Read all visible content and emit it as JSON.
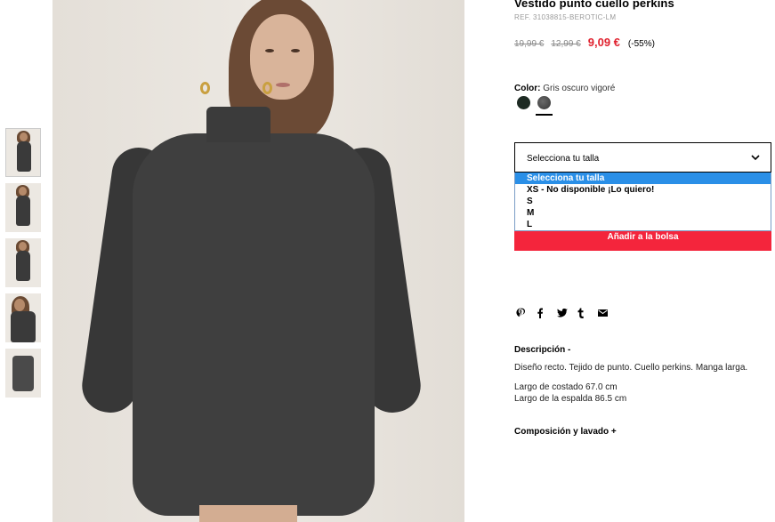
{
  "product": {
    "title": "Vestido punto cuello perkins",
    "ref": "REF. 31038815-BEROTIC-LM",
    "prices": {
      "original_1": "19,99 €",
      "original_2": "12,99 €",
      "current": "9,09 €",
      "discount": "(-55%)"
    },
    "color": {
      "label": "Color:",
      "value": "Gris oscuro vigoré",
      "swatches": [
        "verde-oscuro",
        "gris-oscuro-vigore"
      ]
    },
    "accent_color": "#f4253c",
    "price_color": "#e0222f"
  },
  "size_select": {
    "label": "Selecciona tu talla",
    "options": [
      "Selecciona tu talla",
      "XS - No disponible ¡Lo quiero!",
      "S",
      "M",
      "L"
    ],
    "highlighted_index": 0
  },
  "add_to_bag": "Añadir a la bolsa",
  "share": {
    "icons": [
      "pinterest-icon",
      "facebook-icon",
      "twitter-icon",
      "tumblr-icon",
      "email-icon"
    ]
  },
  "description": {
    "title": "Descripción -",
    "text": "Diseño recto. Tejido de punto. Cuello perkins. Manga larga.",
    "measure_1": "Largo de costado 67.0 cm",
    "measure_2": "Largo de la espalda 86.5 cm"
  },
  "composition": {
    "title": "Composición y lavado +"
  },
  "gallery": {
    "thumbnail_count": 5
  }
}
